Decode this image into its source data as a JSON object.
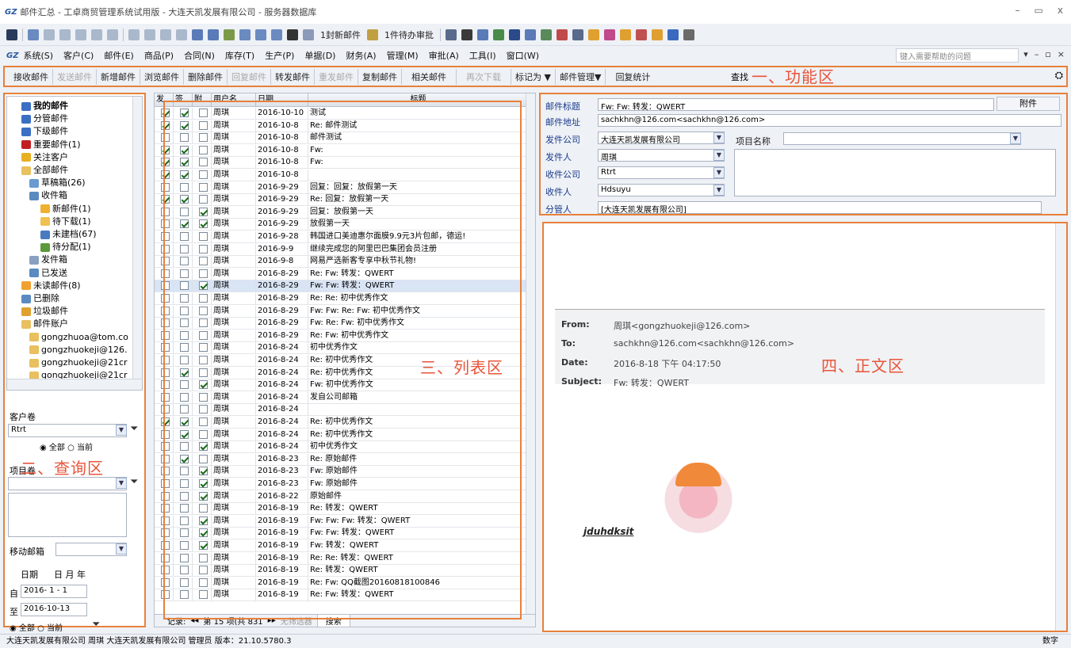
{
  "window": {
    "title": "邮件汇总 - 工卓商贸管理系统试用版 - 大连天凯发展有限公司 - 服务器数据库",
    "logo": "GZ"
  },
  "toolbar": {
    "new_mail": "1封新邮件",
    "approvals": "1件待办审批"
  },
  "menu": {
    "logo": "GZ",
    "items": [
      "系统(S)",
      "客户(C)",
      "邮件(E)",
      "商品(P)",
      "合同(N)",
      "库存(T)",
      "生产(P)",
      "单据(D)",
      "财务(A)",
      "管理(M)",
      "审批(A)",
      "工具(I)",
      "窗口(W)"
    ],
    "help_placeholder": "键入需要帮助的问题"
  },
  "funcbar": {
    "buttons": [
      {
        "label": "接收邮件",
        "enabled": true
      },
      {
        "label": "发送邮件",
        "enabled": false
      },
      {
        "label": "新增邮件",
        "enabled": true
      },
      {
        "label": "浏览邮件",
        "enabled": true
      },
      {
        "label": "删除邮件",
        "enabled": true
      },
      {
        "label": "回复邮件",
        "enabled": false
      },
      {
        "label": "转发邮件",
        "enabled": true
      },
      {
        "label": "重发邮件",
        "enabled": false
      },
      {
        "label": "复制邮件",
        "enabled": true
      },
      {
        "label": "相关邮件",
        "enabled": true
      },
      {
        "label": "再次下载",
        "enabled": false
      },
      {
        "label": "标记为 ▼",
        "enabled": true
      },
      {
        "label": "邮件管理▼",
        "enabled": true
      },
      {
        "label": "回复统计",
        "enabled": true
      }
    ],
    "find": "查找",
    "annotation": "一、功能区"
  },
  "tree": {
    "items": [
      {
        "label": "我的邮件",
        "level": 1,
        "bold": true,
        "color": "#3a6fc4"
      },
      {
        "label": "分管邮件",
        "level": 1,
        "color": "#3a6fc4"
      },
      {
        "label": "下级邮件",
        "level": 1,
        "color": "#3a6fc4"
      },
      {
        "label": "重要邮件(1)",
        "level": 1,
        "color": "#c02020"
      },
      {
        "label": "关注客户",
        "level": 1,
        "color": "#e8b020"
      },
      {
        "label": "全部邮件",
        "level": 1,
        "color": "#e8c060"
      },
      {
        "label": "草稿箱(26)",
        "level": 2,
        "color": "#6a9ad0"
      },
      {
        "label": "收件箱",
        "level": 2,
        "color": "#5a8ac0"
      },
      {
        "label": "新邮件(1)",
        "level": 3,
        "color": "#f0b030"
      },
      {
        "label": "待下载(1)",
        "level": 3,
        "color": "#f0c050"
      },
      {
        "label": "未建档(67)",
        "level": 3,
        "color": "#4a7ac0"
      },
      {
        "label": "待分配(1)",
        "level": 3,
        "color": "#5a9a3a"
      },
      {
        "label": "发件箱",
        "level": 2,
        "color": "#8aa0c0"
      },
      {
        "label": "已发送",
        "level": 2,
        "color": "#5a8ac0"
      },
      {
        "label": "未读邮件(8)",
        "level": 1,
        "color": "#f0a030"
      },
      {
        "label": "已删除",
        "level": 1,
        "color": "#5a8ac0"
      },
      {
        "label": "垃圾邮件",
        "level": 1,
        "color": "#e0a030"
      },
      {
        "label": "邮件账户",
        "level": 1,
        "color": "#e8c060"
      },
      {
        "label": "gongzhuoa@tom.co",
        "level": 2,
        "color": "#e8c060"
      },
      {
        "label": "gongzhuokeji@126.",
        "level": 2,
        "color": "#e8c060"
      },
      {
        "label": "gongzhuokeji@21cr",
        "level": 2,
        "color": "#e8c060"
      },
      {
        "label": "gongzhuokeji@21cr",
        "level": 2,
        "color": "#e8c060"
      }
    ]
  },
  "query": {
    "customer_label": "客户卷",
    "customer_value": "Rtrt",
    "radio_all": "全部",
    "radio_current": "当前",
    "project_label": "项目卷",
    "mobile_label": "移动邮箱",
    "date_label": "日期",
    "date_units": [
      "日",
      "月",
      "年"
    ],
    "from_label": "自",
    "from_value": "2016- 1 - 1",
    "to_label": "至",
    "to_value": "2016-10-13",
    "annotation": "二、查询区"
  },
  "list": {
    "columns": [
      "发",
      "签",
      "附",
      "用户名",
      "日期",
      "标题"
    ],
    "rows": [
      {
        "sent": true,
        "signed": true,
        "att": false,
        "user": "周琪",
        "date": "2016-10-10",
        "title": "测试"
      },
      {
        "sent": true,
        "signed": true,
        "att": false,
        "user": "周琪",
        "date": "2016-10-8",
        "title": "Re: 邮件测试"
      },
      {
        "sent": false,
        "signed": false,
        "att": false,
        "user": "周琪",
        "date": "2016-10-8",
        "title": "邮件测试"
      },
      {
        "sent": true,
        "signed": true,
        "att": false,
        "user": "周琪",
        "date": "2016-10-8",
        "title": "Fw:"
      },
      {
        "sent": true,
        "signed": true,
        "att": false,
        "user": "周琪",
        "date": "2016-10-8",
        "title": "Fw:"
      },
      {
        "sent": true,
        "signed": true,
        "att": false,
        "user": "周琪",
        "date": "2016-10-8",
        "title": ""
      },
      {
        "sent": false,
        "signed": false,
        "att": false,
        "user": "周琪",
        "date": "2016-9-29",
        "title": "回复：回复：放假第一天"
      },
      {
        "sent": true,
        "signed": true,
        "att": false,
        "user": "周琪",
        "date": "2016-9-29",
        "title": "Re: 回复：放假第一天"
      },
      {
        "sent": false,
        "signed": false,
        "att": true,
        "user": "周琪",
        "date": "2016-9-29",
        "title": "回复：放假第一天"
      },
      {
        "sent": false,
        "signed": true,
        "att": true,
        "user": "周琪",
        "date": "2016-9-29",
        "title": "放假第一天"
      },
      {
        "sent": false,
        "signed": false,
        "att": false,
        "user": "周琪",
        "date": "2016-9-28",
        "title": "韩国进口美迪惠尔面膜9.9元3片包邮，德运!"
      },
      {
        "sent": false,
        "signed": false,
        "att": false,
        "user": "周琪",
        "date": "2016-9-9",
        "title": "继续完成您的阿里巴巴集团会员注册"
      },
      {
        "sent": false,
        "signed": false,
        "att": false,
        "user": "周琪",
        "date": "2016-9-8",
        "title": "网易严选新客专享中秋节礼物!"
      },
      {
        "sent": false,
        "signed": false,
        "att": false,
        "user": "周琪",
        "date": "2016-8-29",
        "title": "Re: Fw: 转发：QWERT"
      },
      {
        "sent": false,
        "signed": false,
        "att": true,
        "user": "周琪",
        "date": "2016-8-29",
        "title": "Fw: Fw: 转发：QWERT"
      },
      {
        "sent": false,
        "signed": false,
        "att": false,
        "user": "周琪",
        "date": "2016-8-29",
        "title": "Re: Re: 初中优秀作文"
      },
      {
        "sent": false,
        "signed": false,
        "att": false,
        "user": "周琪",
        "date": "2016-8-29",
        "title": "Fw: Fw: Re: Fw: 初中优秀作文"
      },
      {
        "sent": false,
        "signed": false,
        "att": false,
        "user": "周琪",
        "date": "2016-8-29",
        "title": "Fw: Re: Fw: 初中优秀作文"
      },
      {
        "sent": false,
        "signed": false,
        "att": false,
        "user": "周琪",
        "date": "2016-8-29",
        "title": "Re: Fw: 初中优秀作文"
      },
      {
        "sent": false,
        "signed": false,
        "att": false,
        "user": "周琪",
        "date": "2016-8-24",
        "title": "初中优秀作文"
      },
      {
        "sent": false,
        "signed": false,
        "att": false,
        "user": "周琪",
        "date": "2016-8-24",
        "title": "Re: 初中优秀作文"
      },
      {
        "sent": false,
        "signed": true,
        "att": false,
        "user": "周琪",
        "date": "2016-8-24",
        "title": "Re: 初中优秀作文"
      },
      {
        "sent": false,
        "signed": false,
        "att": true,
        "user": "周琪",
        "date": "2016-8-24",
        "title": "Fw: 初中优秀作文"
      },
      {
        "sent": false,
        "signed": false,
        "att": false,
        "user": "周琪",
        "date": "2016-8-24",
        "title": "发自公司邮箱"
      },
      {
        "sent": false,
        "signed": false,
        "att": false,
        "user": "周琪",
        "date": "2016-8-24",
        "title": ""
      },
      {
        "sent": true,
        "signed": true,
        "att": false,
        "user": "周琪",
        "date": "2016-8-24",
        "title": "Re: 初中优秀作文"
      },
      {
        "sent": false,
        "signed": true,
        "att": false,
        "user": "周琪",
        "date": "2016-8-24",
        "title": "Re: 初中优秀作文"
      },
      {
        "sent": false,
        "signed": false,
        "att": true,
        "user": "周琪",
        "date": "2016-8-24",
        "title": "初中优秀作文"
      },
      {
        "sent": false,
        "signed": true,
        "att": false,
        "user": "周琪",
        "date": "2016-8-23",
        "title": "Re: 原始邮件"
      },
      {
        "sent": false,
        "signed": false,
        "att": true,
        "user": "周琪",
        "date": "2016-8-23",
        "title": "Fw: 原始邮件"
      },
      {
        "sent": false,
        "signed": false,
        "att": true,
        "user": "周琪",
        "date": "2016-8-23",
        "title": "Fw: 原始邮件"
      },
      {
        "sent": false,
        "signed": false,
        "att": true,
        "user": "周琪",
        "date": "2016-8-22",
        "title": "原始邮件"
      },
      {
        "sent": false,
        "signed": false,
        "att": false,
        "user": "周琪",
        "date": "2016-8-19",
        "title": "Re: 转发：QWERT"
      },
      {
        "sent": false,
        "signed": false,
        "att": true,
        "user": "周琪",
        "date": "2016-8-19",
        "title": "Fw: Fw: Fw: 转发：QWERT"
      },
      {
        "sent": false,
        "signed": false,
        "att": true,
        "user": "周琪",
        "date": "2016-8-19",
        "title": "Fw: Fw: 转发：QWERT"
      },
      {
        "sent": false,
        "signed": false,
        "att": true,
        "user": "周琪",
        "date": "2016-8-19",
        "title": "Fw: 转发：QWERT"
      },
      {
        "sent": false,
        "signed": false,
        "att": false,
        "user": "周琪",
        "date": "2016-8-19",
        "title": "Re: Re: 转发：QWERT"
      },
      {
        "sent": false,
        "signed": false,
        "att": false,
        "user": "周琪",
        "date": "2016-8-19",
        "title": "Re: 转发：QWERT"
      },
      {
        "sent": false,
        "signed": false,
        "att": false,
        "user": "周琪",
        "date": "2016-8-19",
        "title": "Re: Fw: QQ截图20160818100846"
      },
      {
        "sent": false,
        "signed": false,
        "att": false,
        "user": "周琪",
        "date": "2016-8-19",
        "title": "Re: Fw: 转发：QWERT"
      }
    ],
    "nav_label": "记录:",
    "nav_value": "第 15 项(共 831",
    "filter_label": "无筛选器",
    "search_label": "搜索",
    "annotation": "三、列表区"
  },
  "detail": {
    "subject_label": "邮件标题",
    "subject_value": "Fw: Fw: 转发：QWERT",
    "attach_button": "附件",
    "address_label": "邮件地址",
    "address_value": "sachkhn@126.com<sachkhn@126.com>",
    "from_company_label": "发件公司",
    "from_company_value": "大连天凯发展有限公司",
    "sender_label": "发件人",
    "sender_value": "周琪",
    "to_company_label": "收件公司",
    "to_company_value": "Rtrt",
    "recipient_label": "收件人",
    "recipient_value": "Hdsuyu",
    "manager_label": "分管人",
    "manager_value": "[大连天凯发展有限公司]",
    "project_label": "项目名称"
  },
  "body": {
    "from_key": "From:",
    "from_value": "周琪<gongzhuokeji@126.com>",
    "to_key": "To:",
    "to_value": "sachkhn@126.com<sachkhn@126.com>",
    "date_key": "Date:",
    "date_value": "2016-8-18 下午 04:17:50",
    "subject_key": "Subject:",
    "subject_value": "Fw: 转发：QWERT",
    "signature": "jduhdksit",
    "annotation": "四、正文区"
  },
  "status": {
    "text": "大连天凯发展有限公司 周琪 大连天凯发展有限公司 管理员 版本：21.10.5780.3",
    "numlock": "数字"
  }
}
